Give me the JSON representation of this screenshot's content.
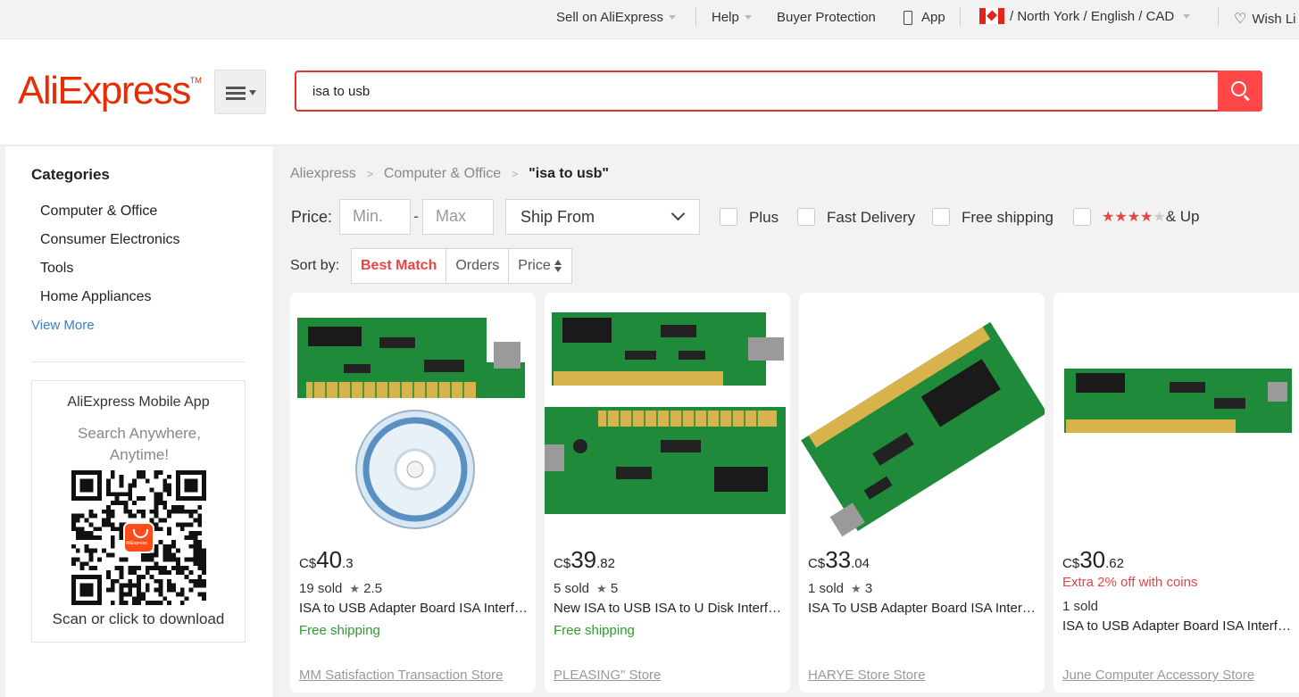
{
  "topbar": {
    "sell": "Sell on AliExpress",
    "help": "Help",
    "buyer_protection": "Buyer Protection",
    "app": "App",
    "region": "/ North York / English /  CAD",
    "wishlist": "Wish Li"
  },
  "header": {
    "logo": "AliExpress",
    "search_value": "isa to usb"
  },
  "sidebar": {
    "title": "Categories",
    "items": [
      "Computer & Office",
      "Consumer Electronics",
      "Tools",
      "Home Appliances"
    ],
    "view_more": "View More",
    "app_title": "AliExpress Mobile App",
    "app_sub": "Search Anywhere, Anytime!",
    "app_download": "Scan or click to download"
  },
  "breadcrumb": {
    "home": "Aliexpress",
    "category": "Computer & Office",
    "current": "\"isa to usb\""
  },
  "filters": {
    "price_label": "Price:",
    "min_placeholder": "Min.",
    "max_placeholder": "Max",
    "ship_from": "Ship From",
    "plus": "Plus",
    "fast_delivery": "Fast Delivery",
    "free_shipping": "Free shipping",
    "rating_suffix": "& Up",
    "rating_stars": 4
  },
  "sort": {
    "label": "Sort by:",
    "best_match": "Best Match",
    "orders": "Orders",
    "price": "Price"
  },
  "products": [
    {
      "currency": "C$",
      "price_int": "40",
      "price_dec": ".3",
      "sold": "19 sold",
      "rating": "2.5",
      "title": "ISA to USB Adapter Board ISA Interface Card",
      "shipping": "Free shipping",
      "store": "MM Satisfaction Transaction Store"
    },
    {
      "currency": "C$",
      "price_int": "39",
      "price_dec": ".82",
      "sold": "5 sold",
      "rating": "5",
      "title": "New ISA to USB ISA to U Disk Interface Card",
      "shipping": "Free shipping",
      "store": "PLEASING\" Store"
    },
    {
      "currency": "C$",
      "price_int": "33",
      "price_dec": ".04",
      "sold": "1 sold",
      "rating": "3",
      "title": "ISA To USB Adapter Board ISA Interface Card",
      "shipping": "",
      "store": "HARYE Store Store"
    },
    {
      "currency": "C$",
      "price_int": "30",
      "price_dec": ".62",
      "coins": "Extra 2% off with coins",
      "sold": "1 sold",
      "rating": "",
      "title": "ISA to USB Adapter Board ISA Interface Card",
      "shipping": "",
      "store": "June Computer Accessory Store"
    }
  ],
  "colors": {
    "brand": "#e62e04",
    "accent": "#ff4747",
    "free_shipping": "#2f9a2f",
    "link": "#3a80c9"
  }
}
